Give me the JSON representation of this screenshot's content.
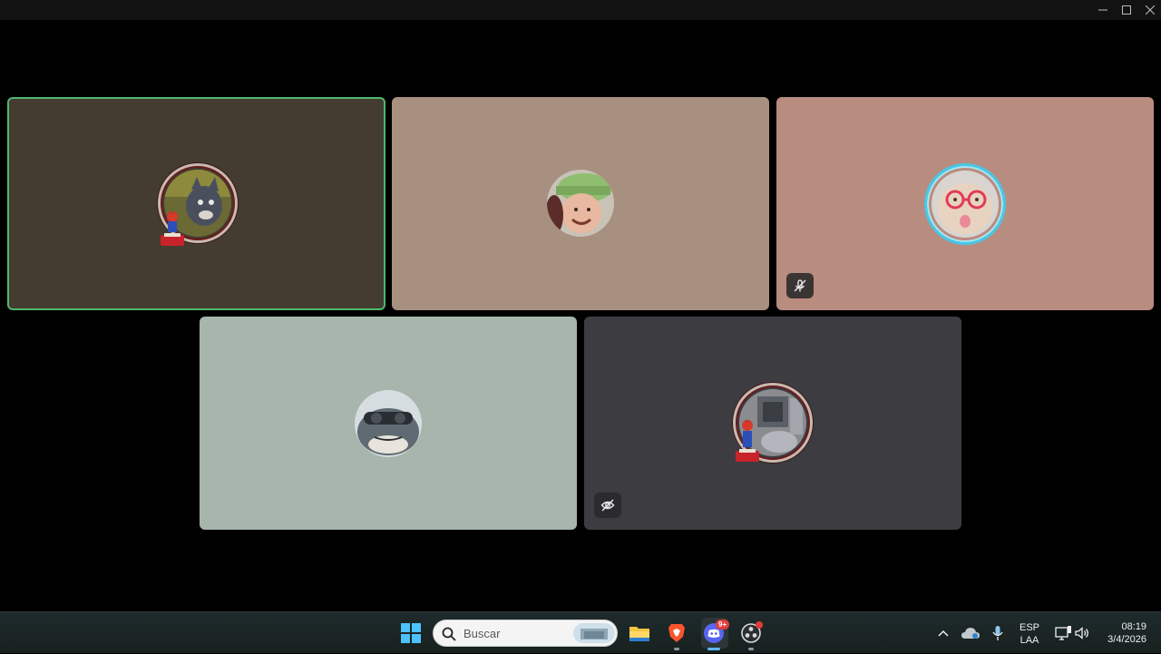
{
  "window": {
    "controls": [
      "minimize-icon",
      "maximize-icon",
      "close-icon"
    ]
  },
  "participants": [
    {
      "avatar": "cartoon-cat-with-figurine",
      "speaking": true,
      "bg": "#443b31"
    },
    {
      "avatar": "person-with-green-cap",
      "speaking": false,
      "bg": "#a89080"
    },
    {
      "avatar": "cat-with-red-glasses",
      "speaking": false,
      "bg": "#b98c80",
      "status_icon": "muted-mic-icon"
    },
    {
      "avatar": "shark-with-goggles",
      "speaking": false,
      "bg": "#a7b5ad"
    },
    {
      "avatar": "room-photo-with-figurine",
      "speaking": false,
      "bg": "#3d3c40",
      "status_icon": "camera-off-icon"
    }
  ],
  "taskbar": {
    "search_placeholder": "Buscar",
    "apps": [
      "windows-start-icon",
      "file-explorer-icon",
      "brave-browser-icon",
      "discord-icon",
      "obs-record-icon"
    ],
    "discord_badge": "9+",
    "tray": {
      "language_line1": "ESP",
      "language_line2": "LAA",
      "time": "08:19",
      "date": "3/4/2026"
    }
  },
  "colors": {
    "speaking_border": "#4fb86c",
    "accent_ring": "#47c7e6",
    "discord_blurple": "#5865f2"
  }
}
